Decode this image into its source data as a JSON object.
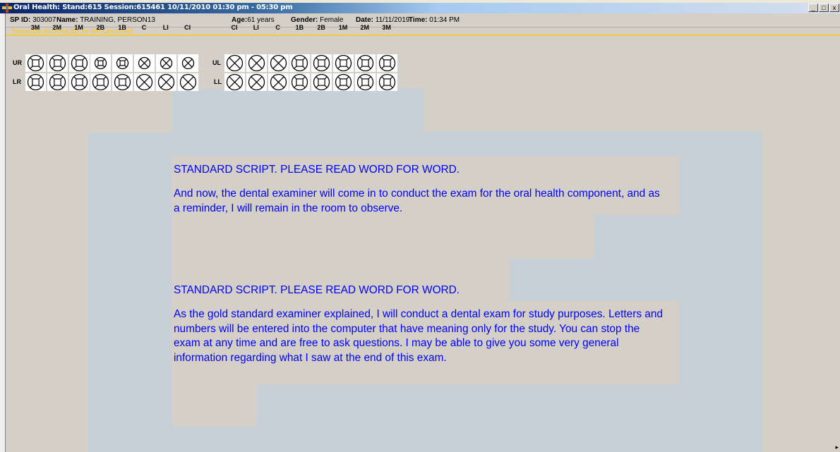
{
  "window": {
    "title": "Oral Health: Stand:615 Session:615461 10/11/2010 01:30 pm - 05:30 pm",
    "controls": [
      "_",
      "□",
      "x"
    ]
  },
  "patient": {
    "sp_id_label": "SP ID:",
    "sp_id": "303007",
    "name_label": "Name:",
    "name": "TRAINING, PERSON13",
    "age_label": "Age:",
    "age": "61 years",
    "gender_label": "Gender:",
    "gender": "Female",
    "date_label": "Date:",
    "date": "11/11/2019",
    "time_label": "Time:",
    "time": "01:34 PM"
  },
  "transition": "Transition Screen(USE by OH Examiner)",
  "tooth_chart": {
    "right_labels": [
      "3M",
      "2M",
      "1M",
      "2B",
      "1B",
      "C",
      "LI",
      "CI"
    ],
    "left_labels": [
      "CI",
      "LI",
      "C",
      "1B",
      "2B",
      "1M",
      "2M",
      "3M"
    ],
    "quadrants": {
      "upper_right": "UR",
      "upper_left": "UL",
      "lower_right": "LR",
      "lower_left": "LL"
    },
    "ur_types": [
      "molar",
      "molar",
      "molar",
      "premolar-small",
      "premolar-small",
      "anterior-small",
      "anterior-small",
      "anterior-small"
    ],
    "ul_types": [
      "anterior",
      "anterior",
      "anterior",
      "molar",
      "molar",
      "molar",
      "molar",
      "molar"
    ],
    "lr_types": [
      "molar",
      "molar",
      "molar",
      "molar",
      "molar",
      "anterior",
      "anterior",
      "anterior"
    ],
    "ll_types": [
      "anterior",
      "anterior",
      "anterior",
      "molar",
      "molar",
      "molar",
      "molar",
      "molar"
    ]
  },
  "scripts": [
    {
      "heading": "STANDARD SCRIPT. PLEASE READ WORD FOR WORD.",
      "body": "And now, the dental examiner will come in to conduct the exam for the oral health component, and as a reminder, I will remain in the room to observe."
    },
    {
      "heading": "STANDARD SCRIPT. PLEASE READ WORD FOR WORD.",
      "body": "As the gold standard examiner explained, I will conduct a dental exam for study purposes.  Letters and numbers will be entered into the computer that have meaning only for the study.  You can stop the exam at any time and are free to ask questions.  I may be able to give you some very general information regarding what I saw at the end of this exam."
    }
  ],
  "colors": {
    "script_text": "#0000ff",
    "transition_text": "#f5c842",
    "background_blue": "#c6d0d6",
    "background_beige": "#d4d0c8"
  }
}
